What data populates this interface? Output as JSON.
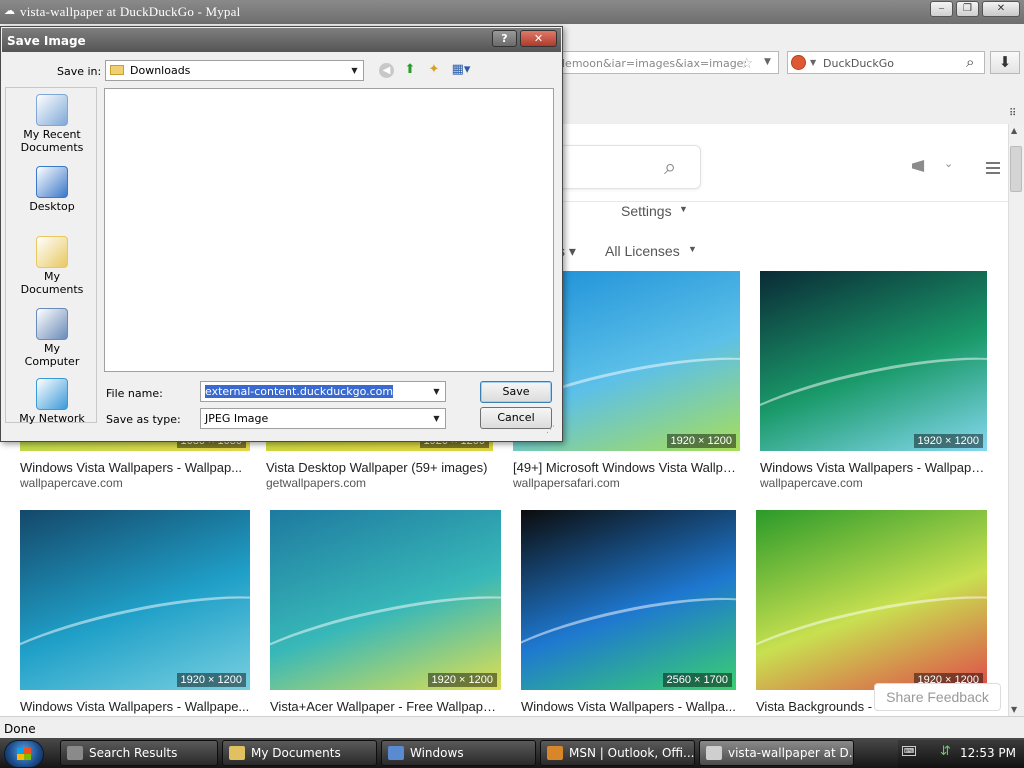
{
  "window": {
    "title": "vista-wallpaper at DuckDuckGo - Mypal",
    "minimize": "–",
    "maximize": "❐",
    "close": "✕"
  },
  "browser": {
    "url_text": "lemoon&iar=images&iax=image:",
    "search_engine": "DuckDuckGo",
    "status": "Done"
  },
  "ddg": {
    "settings_label": "Settings",
    "licenses_label": "All Licenses",
    "share_feedback": "Share Feedback"
  },
  "results": [
    {
      "title": "Windows Vista Wallpapers - Wallpap...",
      "source": "wallpapercave.com",
      "res": "1680 × 1050",
      "colors": [
        "#6fb4d6",
        "#b2d94a",
        "#e6d84a"
      ]
    },
    {
      "title": "Vista Desktop Wallpaper (59+ images)",
      "source": "getwallpapers.com",
      "res": "1920 × 1200",
      "colors": [
        "#56b6b0",
        "#c6d640",
        "#e2d642"
      ]
    },
    {
      "title": "[49+] Microsoft Windows Vista Wallpa...",
      "source": "wallpapersafari.com",
      "res": "1920 × 1200",
      "colors": [
        "#1c8fd8",
        "#5cc0e8",
        "#a8de58"
      ]
    },
    {
      "title": "Windows Vista Wallpapers - Wallpape...",
      "source": "wallpapercave.com",
      "res": "1920 × 1200",
      "colors": [
        "#0a2a36",
        "#1a9a6a",
        "#86d8f0"
      ]
    },
    {
      "title": "Windows Vista Wallpapers - Wallpape...",
      "source": "",
      "res": "1920 × 1200",
      "colors": [
        "#14486a",
        "#20a0c8",
        "#78d0e0"
      ]
    },
    {
      "title": "Vista+Acer Wallpaper - Free Wallpapers",
      "source": "",
      "res": "1920 × 1200",
      "colors": [
        "#1e7aa0",
        "#38b8b8",
        "#e0e050"
      ]
    },
    {
      "title": "Windows Vista Wallpapers - Wallpa...",
      "source": "",
      "res": "2560 × 1700",
      "colors": [
        "#0c0c0c",
        "#1e78d0",
        "#3ad070"
      ]
    },
    {
      "title": "Vista Backgrounds - ...",
      "source": "",
      "res": "1920 × 1200",
      "colors": [
        "#2a9a2a",
        "#c8e050",
        "#e04a4a"
      ]
    }
  ],
  "dialog": {
    "title": "Save Image",
    "help": "?",
    "close": "✕",
    "save_in_label": "Save in:",
    "save_in_value": "Downloads",
    "places": [
      {
        "label": "My Recent Documents",
        "color": "#7fa8d8"
      },
      {
        "label": "Desktop",
        "color": "#3a78c8"
      },
      {
        "label": "My Documents",
        "color": "#e8c860"
      },
      {
        "label": "My Computer",
        "color": "#6a8ab8"
      },
      {
        "label": "My Network",
        "color": "#3a9ad8"
      }
    ],
    "file_name_label": "File name:",
    "file_name_value": "external-content.duckduckgo.com",
    "save_type_label": "Save as type:",
    "save_type_value": "JPEG Image",
    "save_button": "Save",
    "cancel_button": "Cancel"
  },
  "taskbar": {
    "items": [
      {
        "label": "Search Results",
        "color": "#8a8a8a"
      },
      {
        "label": "My Documents",
        "color": "#e0c060"
      },
      {
        "label": "Windows",
        "color": "#5a8ad0"
      },
      {
        "label": "MSN | Outlook, Offi...",
        "color": "#d8862a"
      },
      {
        "label": "vista-wallpaper at D...",
        "color": "#cfcfcf"
      }
    ],
    "clock": "12:53 PM"
  }
}
